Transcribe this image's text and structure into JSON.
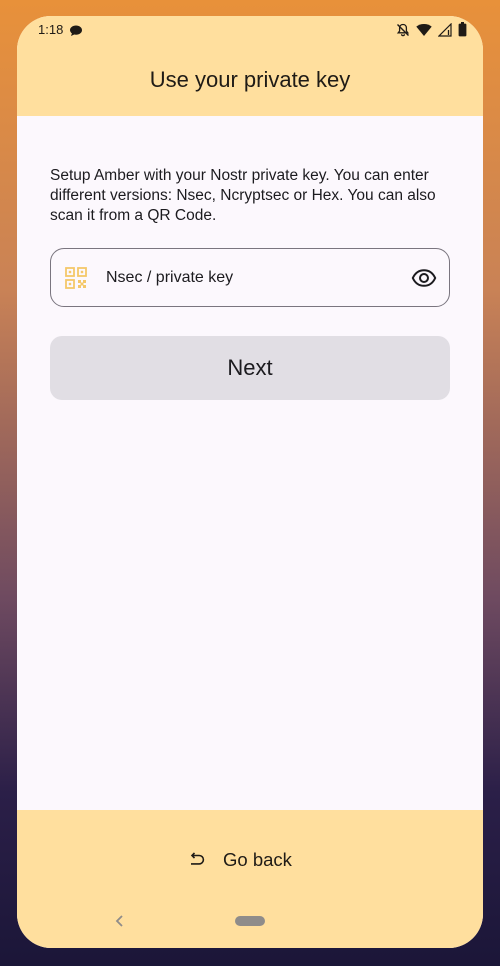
{
  "status_bar": {
    "time": "1:18",
    "left_icon": "chat-bubble-icon",
    "right_icons": [
      "notifications-off-icon",
      "wifi-icon",
      "signal-icon",
      "battery-icon"
    ]
  },
  "app_bar": {
    "title": "Use your private key"
  },
  "main": {
    "description": "Setup Amber with your Nostr private key. You can enter different versions: Nsec, Ncryptsec or Hex. You can also scan it from a QR Code.",
    "key_field": {
      "placeholder": "Nsec / private key",
      "value": "",
      "leading_icon": "qr-code-scan-icon",
      "trailing_icon": "eye-visibility-icon"
    },
    "next_label": "Next"
  },
  "bottom_bar": {
    "go_back_label": "Go back",
    "go_back_icon": "undo-arrow-icon"
  },
  "navigation": {
    "back_icon": "nav-back-chevron-icon",
    "home_icon": "nav-home-pill-icon"
  },
  "colors": {
    "accent_bar": "#ffdf9e",
    "surface": "#fcf8fd",
    "button_disabled": "#e1dee4",
    "qr_icon": "#f4c86a",
    "text": "#1c1b1f"
  }
}
